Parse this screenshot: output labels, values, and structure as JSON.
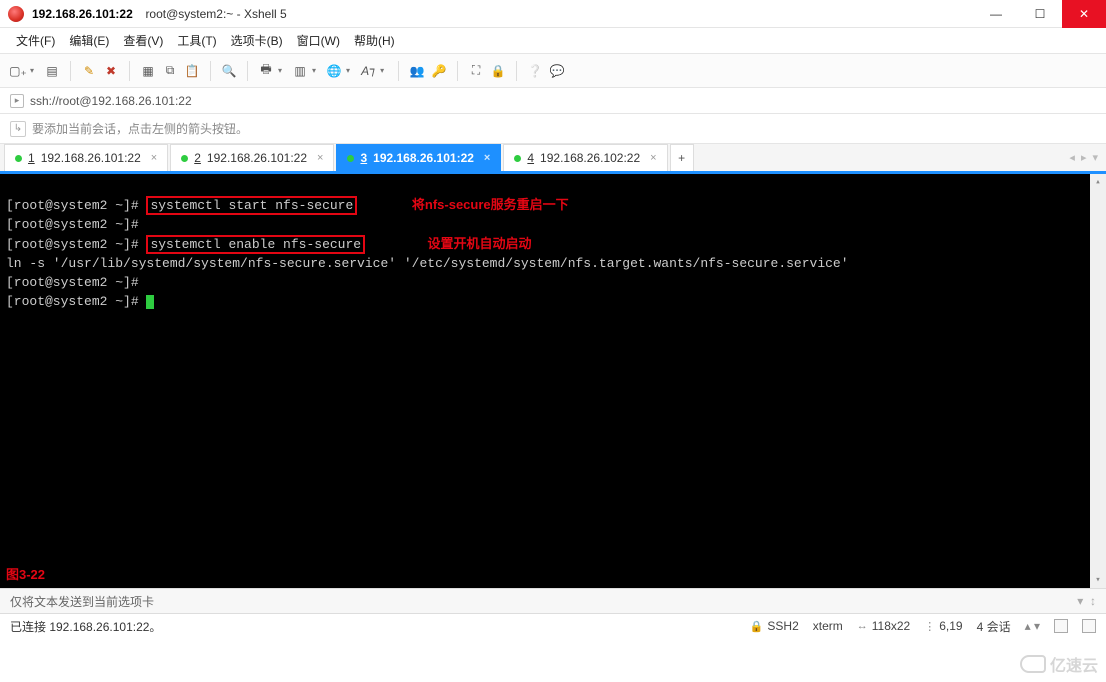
{
  "title": {
    "host": "192.168.26.101:22",
    "session": "root@system2:~",
    "app": "Xshell 5"
  },
  "menus": {
    "file": "文件(F)",
    "edit": "编辑(E)",
    "view": "查看(V)",
    "tools": "工具(T)",
    "tab": "选项卡(B)",
    "window": "窗口(W)",
    "help": "帮助(H)"
  },
  "address": {
    "url": "ssh://root@192.168.26.101:22"
  },
  "hint": {
    "text": "要添加当前会话，点击左侧的箭头按钮。"
  },
  "tabs": [
    {
      "num": "1",
      "label": "192.168.26.101:22",
      "active": false
    },
    {
      "num": "2",
      "label": "192.168.26.101:22",
      "active": false
    },
    {
      "num": "3",
      "label": "192.168.26.101:22",
      "active": true
    },
    {
      "num": "4",
      "label": "192.168.26.102:22",
      "active": false
    }
  ],
  "terminal": {
    "prompt": "[root@system2 ~]#",
    "cmd1": "systemctl start nfs-secure",
    "ann1": "将nfs-secure服务重启一下",
    "cmd2": "systemctl enable nfs-secure",
    "ann2": "设置开机自动启动",
    "ln_out": "ln -s '/usr/lib/systemd/system/nfs-secure.service' '/etc/systemd/system/nfs.target.wants/nfs-secure.service'",
    "fig": "图3-22"
  },
  "sendbar": {
    "text": "仅将文本发送到当前选项卡"
  },
  "status": {
    "conn": "已连接 192.168.26.101:22。",
    "proto": "SSH2",
    "term": "xterm",
    "size": "118x22",
    "pos": "6,19",
    "sessions": "4 会话"
  },
  "watermark": "亿速云"
}
